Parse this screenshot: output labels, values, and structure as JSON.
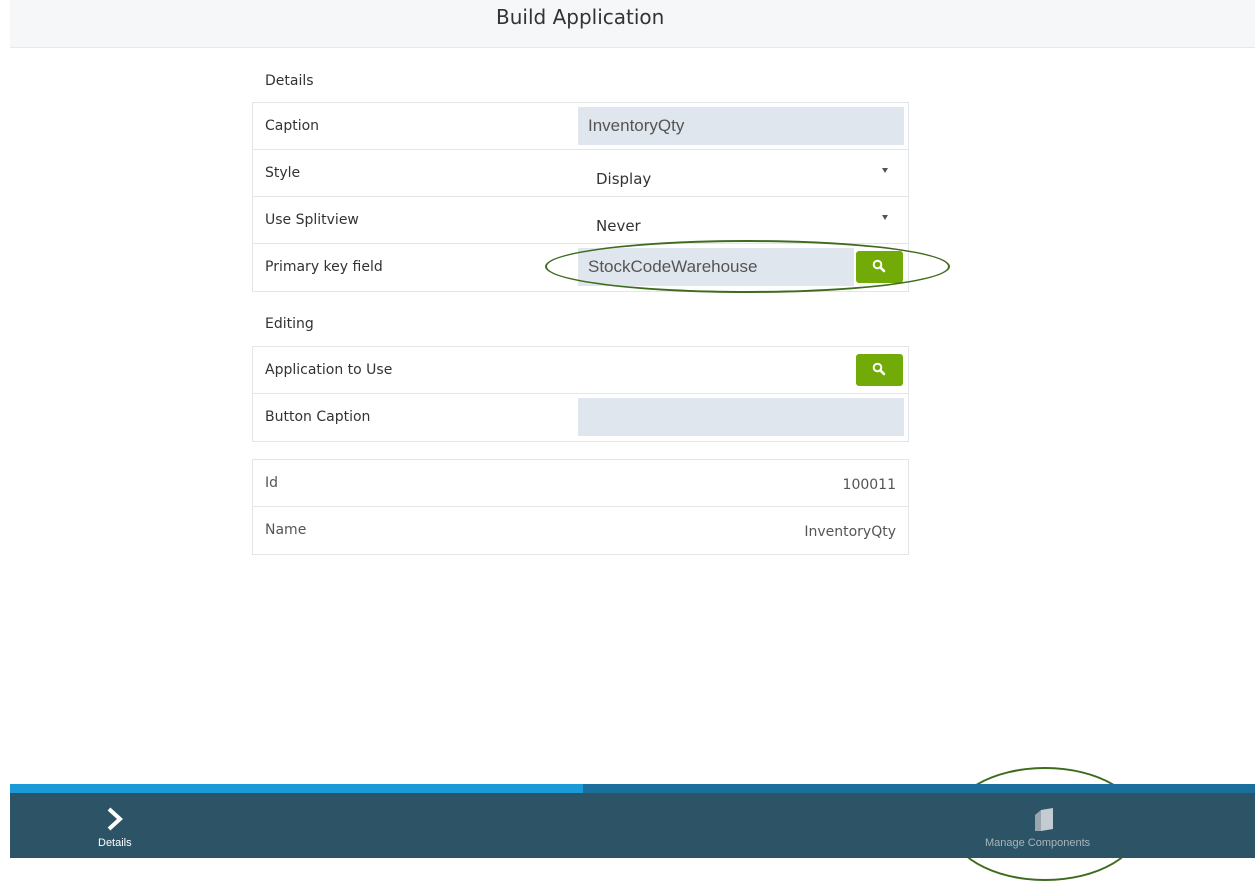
{
  "header": {
    "title": "Build Application"
  },
  "details": {
    "section_label": "Details",
    "caption": {
      "label": "Caption",
      "value": "InventoryQty"
    },
    "style": {
      "label": "Style",
      "value": "Display"
    },
    "splitview": {
      "label": "Use Splitview",
      "value": "Never"
    },
    "primary_key": {
      "label": "Primary key field",
      "value": "StockCodeWarehouse"
    }
  },
  "editing": {
    "section_label": "Editing",
    "application": {
      "label": "Application to Use",
      "value": ""
    },
    "button_caption": {
      "label": "Button Caption",
      "value": ""
    }
  },
  "info": {
    "id": {
      "label": "Id",
      "value": "100011"
    },
    "name": {
      "label": "Name",
      "value": "InventoryQty"
    }
  },
  "progress": {
    "fraction": 0.46
  },
  "footer": {
    "details_label": "Details",
    "manage_components_label": "Manage Components"
  },
  "icons": {
    "search": "search-icon",
    "chevron": "chevron-right-icon",
    "components": "components-icon"
  },
  "colors": {
    "accent_green": "#72ab08",
    "footer_bg": "#2d5466",
    "progress_fill": "#1a9ad6",
    "field_bg": "#dfe6ed"
  }
}
